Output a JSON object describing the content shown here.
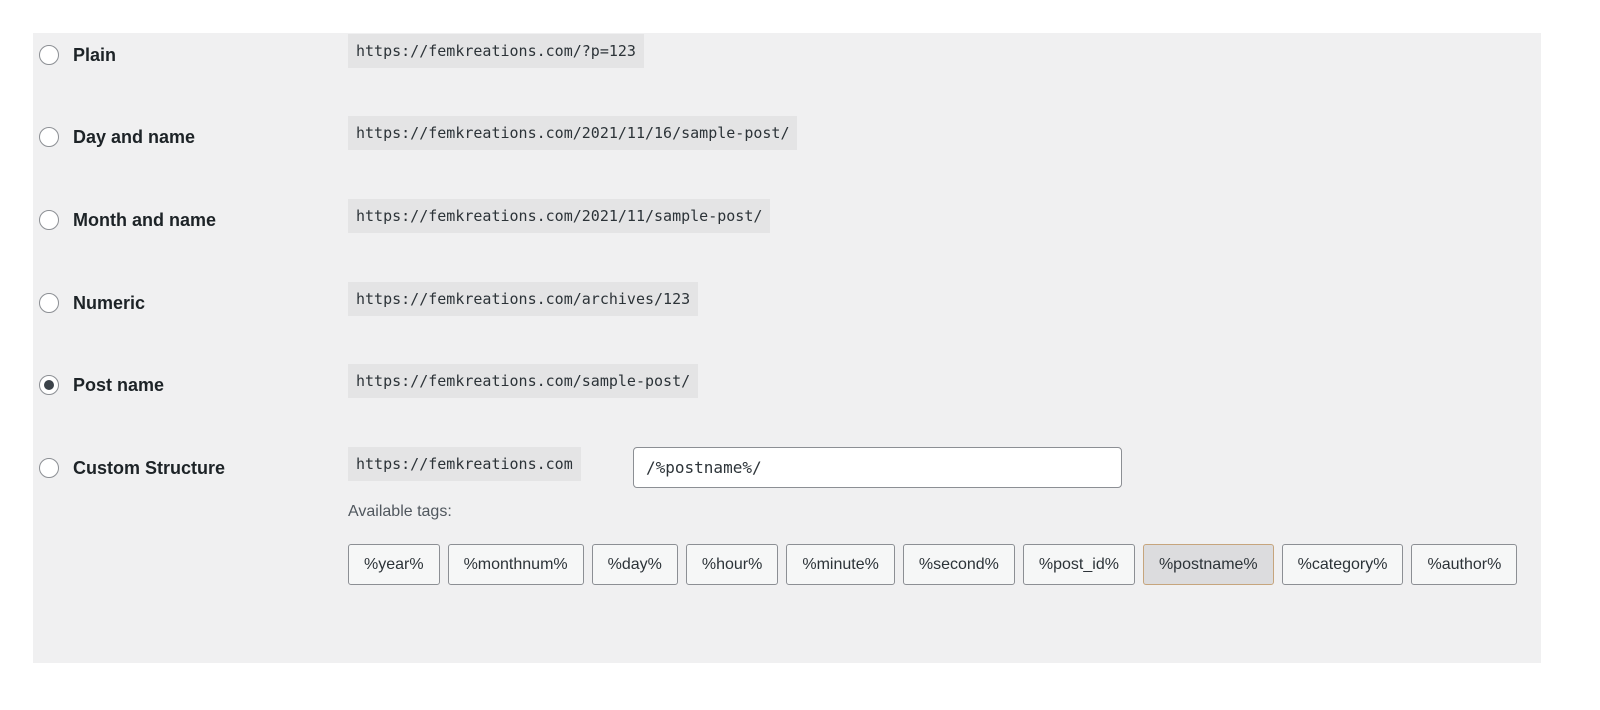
{
  "options": [
    {
      "label": "Plain",
      "example": "https://femkreations.com/?p=123",
      "checked": false
    },
    {
      "label": "Day and name",
      "example": "https://femkreations.com/2021/11/16/sample-post/",
      "checked": false
    },
    {
      "label": "Month and name",
      "example": "https://femkreations.com/2021/11/sample-post/",
      "checked": false
    },
    {
      "label": "Numeric",
      "example": "https://femkreations.com/archives/123",
      "checked": false
    },
    {
      "label": "Post name",
      "example": "https://femkreations.com/sample-post/",
      "checked": true
    },
    {
      "label": "Custom Structure",
      "example": "https://femkreations.com",
      "checked": false
    }
  ],
  "custom": {
    "value": "/%postname%/",
    "available_tags_label": "Available tags:",
    "tags": [
      {
        "label": "%year%",
        "active": false
      },
      {
        "label": "%monthnum%",
        "active": false
      },
      {
        "label": "%day%",
        "active": false
      },
      {
        "label": "%hour%",
        "active": false
      },
      {
        "label": "%minute%",
        "active": false
      },
      {
        "label": "%second%",
        "active": false
      },
      {
        "label": "%post_id%",
        "active": false
      },
      {
        "label": "%postname%",
        "active": true
      },
      {
        "label": "%category%",
        "active": false
      },
      {
        "label": "%author%",
        "active": false
      }
    ]
  }
}
